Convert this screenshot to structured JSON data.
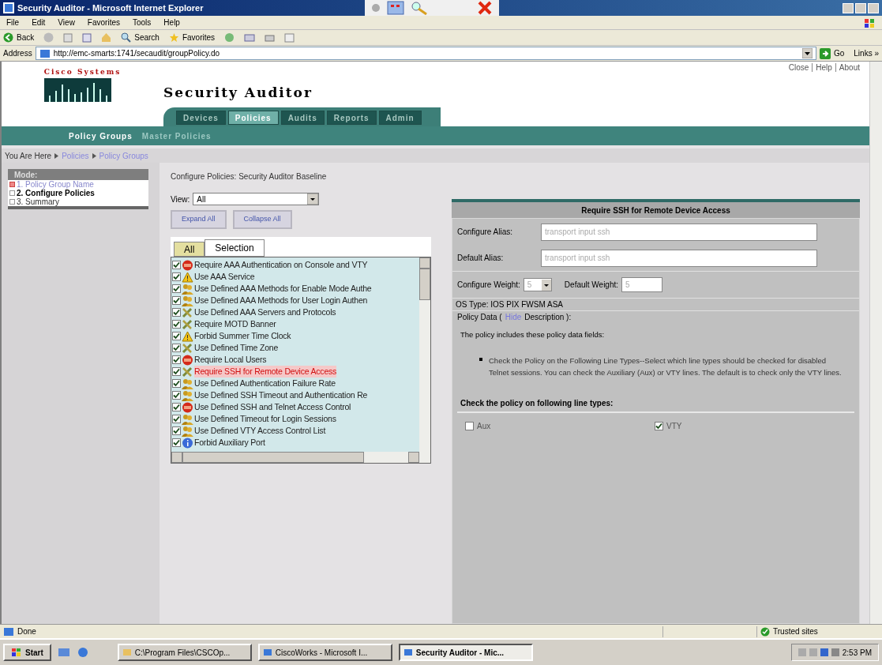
{
  "window": {
    "title": "Security Auditor - Microsoft Internet Explorer"
  },
  "menu": [
    "File",
    "Edit",
    "View",
    "Favorites",
    "Tools",
    "Help"
  ],
  "toolbar": {
    "back": "Back",
    "search": "Search",
    "favorites": "Favorites"
  },
  "address": {
    "label": "Address",
    "url": "http://emc-smarts:1741/secaudit/groupPolicy.do",
    "go": "Go",
    "links": "Links »"
  },
  "header": {
    "logo": "Cisco Systems",
    "title": "Security Auditor",
    "links": [
      "Close",
      "Help",
      "About"
    ]
  },
  "tabs": [
    {
      "label": "Devices",
      "selected": false
    },
    {
      "label": "Policies",
      "selected": true
    },
    {
      "label": "Audits",
      "selected": false
    },
    {
      "label": "Reports",
      "selected": false
    },
    {
      "label": "Admin",
      "selected": false
    }
  ],
  "subtabs": [
    {
      "label": "Policy Groups",
      "selected": true
    },
    {
      "label": "Master Policies",
      "selected": false
    }
  ],
  "breadcrumb": {
    "label": "You Are Here",
    "items": [
      "Policies",
      "Policy Groups"
    ]
  },
  "mode": {
    "title": "Mode:",
    "steps": [
      {
        "label": "1. Policy Group Name",
        "done": true,
        "current": false
      },
      {
        "label": "2. Configure Policies",
        "done": false,
        "current": true
      },
      {
        "label": "3. Summary",
        "done": false,
        "current": false
      }
    ]
  },
  "configure": {
    "title": "Configure Policies: Security Auditor Baseline",
    "view_label": "View:",
    "view_value": "All",
    "buttons": [
      "Expand All",
      "Collapse All"
    ],
    "tabs": [
      {
        "label": "All",
        "selected": false
      },
      {
        "label": "Selection",
        "selected": true
      }
    ],
    "policies": [
      {
        "label": "Require AAA Authentication on Console and VTY",
        "kind": "critical",
        "checked": true,
        "selected": false
      },
      {
        "label": "Use AAA Service",
        "kind": "warning",
        "checked": true,
        "selected": false
      },
      {
        "label": "Use Defined AAA Methods for Enable Mode Authe",
        "kind": "group",
        "checked": true,
        "selected": false
      },
      {
        "label": "Use Defined AAA Methods for User Login Authen",
        "kind": "group",
        "checked": true,
        "selected": false
      },
      {
        "label": "Use Defined AAA Servers and Protocols",
        "kind": "tools",
        "checked": true,
        "selected": false
      },
      {
        "label": "Require MOTD Banner",
        "kind": "tools",
        "checked": true,
        "selected": false
      },
      {
        "label": "Forbid Summer Time Clock",
        "kind": "warning",
        "checked": true,
        "selected": false
      },
      {
        "label": "Use Defined Time Zone",
        "kind": "tools",
        "checked": true,
        "selected": false
      },
      {
        "label": "Require Local Users",
        "kind": "critical",
        "checked": true,
        "selected": false
      },
      {
        "label": "Require SSH for Remote Device Access",
        "kind": "tools",
        "checked": true,
        "selected": true
      },
      {
        "label": "Use Defined Authentication Failure Rate",
        "kind": "group",
        "checked": true,
        "selected": false
      },
      {
        "label": "Use Defined SSH Timeout and Authentication Re",
        "kind": "group",
        "checked": true,
        "selected": false
      },
      {
        "label": "Use Defined SSH and Telnet Access Control",
        "kind": "critical",
        "checked": true,
        "selected": false
      },
      {
        "label": "Use Defined Timeout for Login Sessions",
        "kind": "group",
        "checked": true,
        "selected": false
      },
      {
        "label": "Use Defined VTY Access Control List",
        "kind": "group",
        "checked": true,
        "selected": false
      },
      {
        "label": "Forbid Auxiliary Port",
        "kind": "info",
        "checked": true,
        "selected": false
      }
    ]
  },
  "detail": {
    "title": "Require SSH for Remote Device Access",
    "configure_alias": {
      "label": "Configure Alias:",
      "value": "transport input ssh"
    },
    "default_alias": {
      "label": "Default Alias:",
      "value": "transport input ssh"
    },
    "configure_weight": {
      "label": "Configure Weight:",
      "value": "5"
    },
    "default_weight": {
      "label": "Default Weight:",
      "value": "5"
    },
    "os_type": "OS Type: IOS PIX FWSM ASA",
    "policy_data": {
      "before": "Policy Data (",
      "link": "Hide",
      "after": "Description ):"
    },
    "intro": "The policy includes these policy data fields:",
    "bullets": [
      "Check the Policy on the Following Line Types--Select which line types should be checked for disabled Telnet sessions. You can check the Auxiliary (Aux) or VTY lines. The default is to check only the VTY lines."
    ],
    "line_types_title": "Check the policy on following line types:",
    "line_types": [
      {
        "label": "Aux",
        "checked": false
      },
      {
        "label": "VTY",
        "checked": true
      }
    ]
  },
  "status_bar": {
    "text": "Done",
    "zone": "Trusted sites"
  },
  "taskbar": {
    "start": "Start",
    "tasks": [
      {
        "label": "C:\\Program Files\\CSCOp...",
        "selected": false
      },
      {
        "label": "CiscoWorks - Microsoft I...",
        "selected": false
      },
      {
        "label": "Security Auditor - Mic...",
        "selected": true
      }
    ],
    "time": "2:53 PM"
  }
}
